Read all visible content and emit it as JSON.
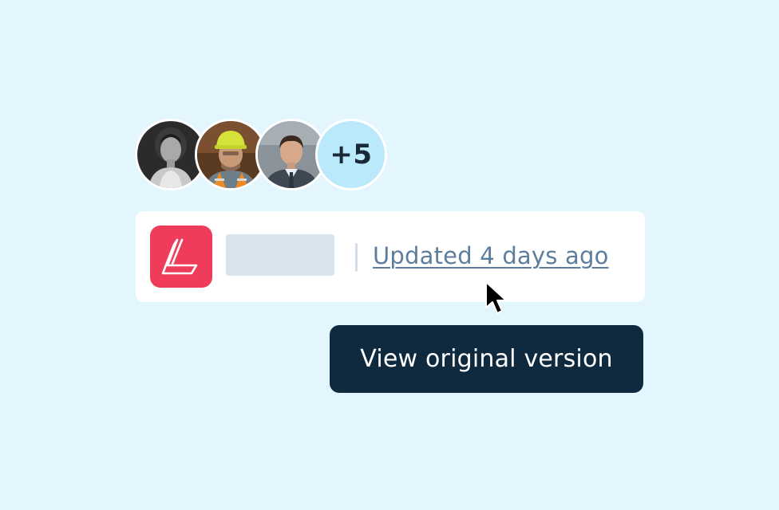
{
  "collaborators": {
    "avatars": [
      {
        "name": "woman-portrait-avatar"
      },
      {
        "name": "construction-worker-avatar"
      },
      {
        "name": "man-portrait-avatar"
      }
    ],
    "overflow_count_label": "+5"
  },
  "file_card": {
    "app_icon": "letter-l-logo-icon",
    "updated_label": "Updated 4 days ago"
  },
  "tooltip": {
    "label": "View original version"
  },
  "colors": {
    "background": "#e3f5fd",
    "card": "#ffffff",
    "brand_red": "#ef3c5a",
    "link": "#5d7d9c",
    "tooltip_bg": "#0f2a3f",
    "overflow_badge": "#b9e9fb"
  }
}
